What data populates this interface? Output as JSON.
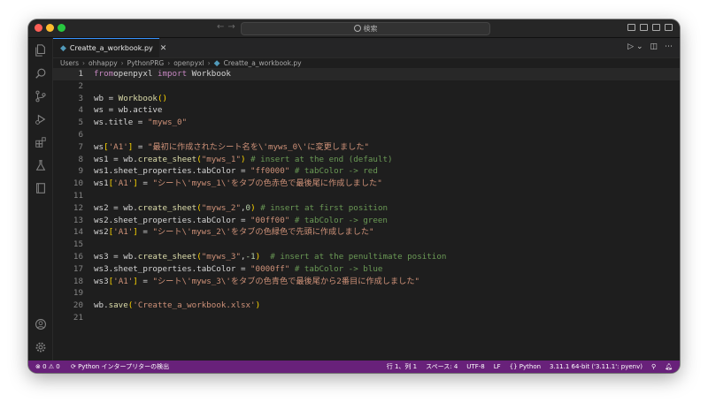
{
  "titlebar": {
    "search_placeholder": "検索",
    "nav_back": "←",
    "nav_forward": "→"
  },
  "tab": {
    "filename": "Creatte_a_workbook.py",
    "close": "✕"
  },
  "breadcrumb": [
    "Users",
    "ohhappy",
    "PythonPRG",
    "openpyxl",
    "Creatte_a_workbook.py"
  ],
  "code_lines": [
    {
      "n": "1",
      "tokens": [
        [
          "kw",
          "from"
        ],
        [
          "",
          "openpyxl "
        ],
        [
          "kw",
          "import"
        ],
        [
          "",
          " Workbook"
        ]
      ]
    },
    {
      "n": "2",
      "tokens": []
    },
    {
      "n": "3",
      "tokens": [
        [
          "",
          "wb = "
        ],
        [
          "fn",
          "Workbook"
        ],
        [
          "br1",
          "()"
        ]
      ]
    },
    {
      "n": "4",
      "tokens": [
        [
          "",
          "ws = wb.active"
        ]
      ]
    },
    {
      "n": "5",
      "tokens": [
        [
          "",
          "ws.title = "
        ],
        [
          "str",
          "\"myws_0\""
        ]
      ]
    },
    {
      "n": "6",
      "tokens": []
    },
    {
      "n": "7",
      "tokens": [
        [
          "",
          "ws"
        ],
        [
          "br1",
          "["
        ],
        [
          "str",
          "'A1'"
        ],
        [
          "br1",
          "]"
        ],
        [
          "",
          " = "
        ],
        [
          "str",
          "\"最初に作成されたシート名を\\'myws_0\\'に変更しました\""
        ]
      ]
    },
    {
      "n": "8",
      "tokens": [
        [
          "",
          "ws1 = wb."
        ],
        [
          "fn",
          "create_sheet"
        ],
        [
          "br1",
          "("
        ],
        [
          "str",
          "\"myws_1\""
        ],
        [
          "br1",
          ")"
        ],
        [
          "",
          " "
        ],
        [
          "com",
          "# insert at the end (default)"
        ]
      ]
    },
    {
      "n": "9",
      "tokens": [
        [
          "",
          "ws1.sheet_properties.tabColor = "
        ],
        [
          "str",
          "\"ff0000\""
        ],
        [
          "",
          " "
        ],
        [
          "com",
          "# tabColor -> red"
        ]
      ]
    },
    {
      "n": "10",
      "tokens": [
        [
          "",
          "ws1"
        ],
        [
          "br1",
          "["
        ],
        [
          "str",
          "'A1'"
        ],
        [
          "br1",
          "]"
        ],
        [
          "",
          " = "
        ],
        [
          "str",
          "\"シート\\'myws_1\\'をタブの色赤色で最後尾に作成しました\""
        ]
      ]
    },
    {
      "n": "11",
      "tokens": []
    },
    {
      "n": "12",
      "tokens": [
        [
          "",
          "ws2 = wb."
        ],
        [
          "fn",
          "create_sheet"
        ],
        [
          "br1",
          "("
        ],
        [
          "str",
          "\"myws_2\""
        ],
        [
          "",
          ","
        ],
        [
          "num",
          "0"
        ],
        [
          "br1",
          ")"
        ],
        [
          "",
          " "
        ],
        [
          "com",
          "# insert at first position"
        ]
      ]
    },
    {
      "n": "13",
      "tokens": [
        [
          "",
          "ws2.sheet_properties.tabColor = "
        ],
        [
          "str",
          "\"00ff00\""
        ],
        [
          "",
          " "
        ],
        [
          "com",
          "# tabColor -> green"
        ]
      ]
    },
    {
      "n": "14",
      "tokens": [
        [
          "",
          "ws2"
        ],
        [
          "br1",
          "["
        ],
        [
          "str",
          "'A1'"
        ],
        [
          "br1",
          "]"
        ],
        [
          "",
          " = "
        ],
        [
          "str",
          "\"シート\\'myws_2\\'をタブの色緑色で先頭に作成しました\""
        ]
      ]
    },
    {
      "n": "15",
      "tokens": []
    },
    {
      "n": "16",
      "tokens": [
        [
          "",
          "ws3 = wb."
        ],
        [
          "fn",
          "create_sheet"
        ],
        [
          "br1",
          "("
        ],
        [
          "str",
          "\"myws_3\""
        ],
        [
          "",
          ","
        ],
        [
          "num",
          "-1"
        ],
        [
          "br1",
          ")"
        ],
        [
          "",
          "  "
        ],
        [
          "com",
          "# insert at the penultimate position"
        ]
      ]
    },
    {
      "n": "17",
      "tokens": [
        [
          "",
          "ws3.sheet_properties.tabColor = "
        ],
        [
          "str",
          "\"0000ff\""
        ],
        [
          "",
          " "
        ],
        [
          "com",
          "# tabColor -> blue"
        ]
      ]
    },
    {
      "n": "18",
      "tokens": [
        [
          "",
          "ws3"
        ],
        [
          "br1",
          "["
        ],
        [
          "str",
          "'A1'"
        ],
        [
          "br1",
          "]"
        ],
        [
          "",
          " = "
        ],
        [
          "str",
          "\"シート\\'myws_3\\'をタブの色青色で最後尾から2番目に作成しました\""
        ]
      ]
    },
    {
      "n": "19",
      "tokens": []
    },
    {
      "n": "20",
      "tokens": [
        [
          "",
          "wb."
        ],
        [
          "fn",
          "save"
        ],
        [
          "br1",
          "("
        ],
        [
          "str",
          "'Creatte_a_workbook.xlsx'"
        ],
        [
          "br1",
          ")"
        ]
      ]
    },
    {
      "n": "21",
      "tokens": []
    }
  ],
  "current_line": "1",
  "statusbar": {
    "problems": "⊗ 0 ⚠ 0",
    "interpreter_detect": "Python インタープリターの検出",
    "position": "行 1、列 1",
    "spaces": "スペース: 4",
    "encoding": "UTF-8",
    "eol": "LF",
    "language": "Python",
    "interpreter": "3.11.1 64-bit ('3.11.1': pyenv)"
  },
  "colors": {
    "statusbar": "#68217a",
    "editor_bg": "#1e1e1e",
    "accent": "#3794ff"
  },
  "icons": {
    "activity_bar": [
      "explorer-icon",
      "search-icon",
      "source-control-icon",
      "run-debug-icon",
      "extensions-icon",
      "testing-icon",
      "notebook-icon"
    ],
    "activity_bottom": [
      "account-icon",
      "settings-gear-icon"
    ]
  }
}
